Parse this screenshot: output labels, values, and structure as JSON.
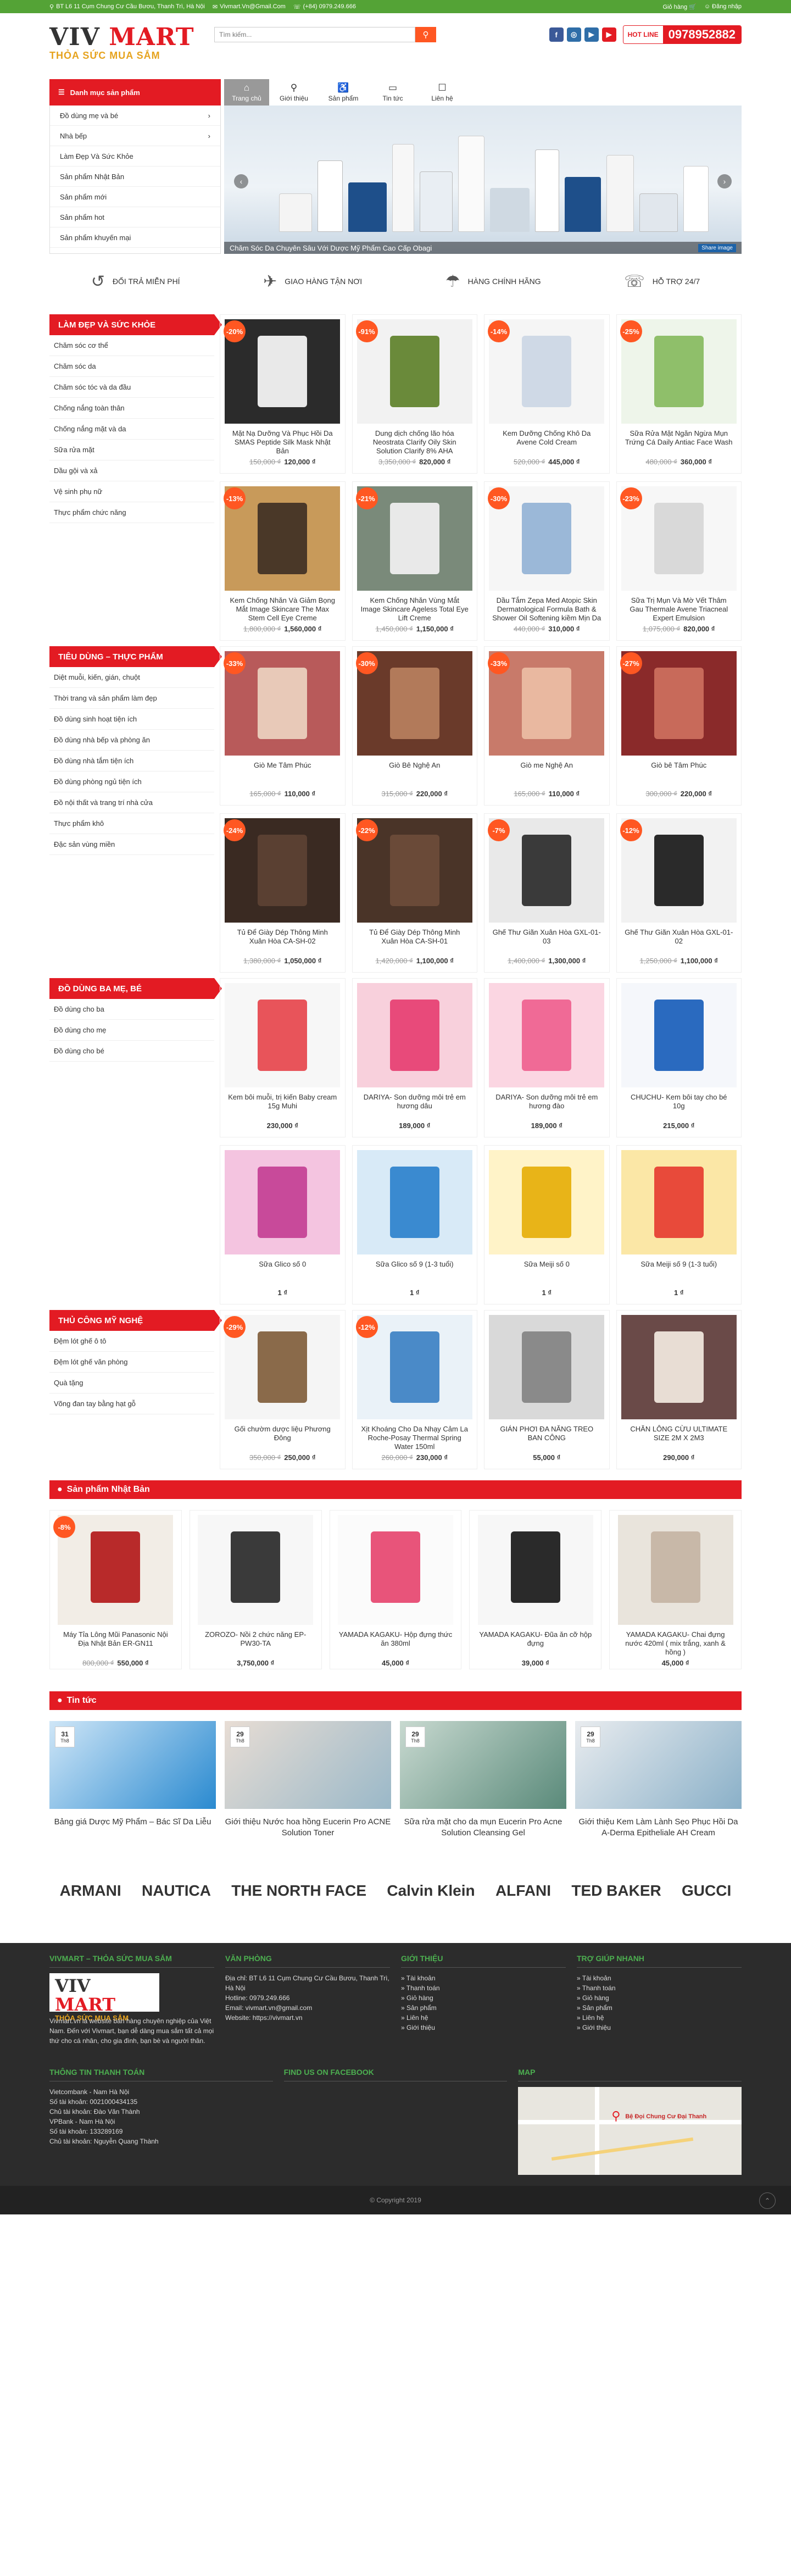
{
  "topbar": {
    "address": "BT L6 11 Cụm Chung Cư Cầu Bươu, Thanh Trì, Hà Nội",
    "email": "Vivmart.Vn@Gmail.Com",
    "phone": "(+84) 0979.249.666",
    "cart": "Giỏ hàng",
    "login": "Đăng nhập"
  },
  "header": {
    "logo_main_a": "VIV",
    "logo_main_b": "MART",
    "logo_tagline": "THỎA SỨC MUA SẮM",
    "search_placeholder": "Tìm kiếm...",
    "hotline_label": "HOT LINE",
    "hotline_number": "0978952882"
  },
  "socials": [
    {
      "icon": "facebook-icon",
      "glyph": "f",
      "color": "#3b5998"
    },
    {
      "icon": "instagram-icon",
      "glyph": "◎",
      "color": "#2f6ea8"
    },
    {
      "icon": "youtube-icon",
      "glyph": "▶",
      "color": "#2f6ea8"
    },
    {
      "icon": "youtube-red-icon",
      "glyph": "▶",
      "color": "#e31b23"
    }
  ],
  "nav": {
    "category_title": "Danh mục sản phẩm",
    "items": [
      {
        "label": "Trang chủ",
        "icon": "⌂"
      },
      {
        "label": "Giới thiệu",
        "icon": "⚲"
      },
      {
        "label": "Sản phẩm",
        "icon": "♿"
      },
      {
        "label": "Tin tức",
        "icon": "▭"
      },
      {
        "label": "Liên hệ",
        "icon": "☐"
      }
    ]
  },
  "category_menu": [
    {
      "label": "Đồ dùng mẹ và bé",
      "arrow": "›"
    },
    {
      "label": "Nhà bếp",
      "arrow": "›"
    },
    {
      "label": "Làm Đẹp Và Sức Khỏe",
      "arrow": ""
    },
    {
      "label": "Sản phẩm Nhật Bản",
      "arrow": ""
    },
    {
      "label": "Sản phẩm mới",
      "arrow": ""
    },
    {
      "label": "Sản phẩm hot",
      "arrow": ""
    },
    {
      "label": "Sản phẩm khuyến mại",
      "arrow": ""
    }
  ],
  "slider": {
    "caption": "Chăm Sóc Da Chuyên Sâu Với Dược Mỹ Phẩm Cao Cấp Obagi",
    "share": "Share image"
  },
  "services": [
    {
      "icon": "↺",
      "label": "ĐỔI TRẢ MIỄN PHÍ"
    },
    {
      "icon": "✈",
      "label": "GIAO HÀNG TẬN NƠI"
    },
    {
      "icon": "☂",
      "label": "HÀNG CHÍNH HÃNG"
    },
    {
      "icon": "☏",
      "label": "HỖ TRỢ 24/7"
    }
  ],
  "sections": [
    {
      "title": "LÀM ĐẸP VÀ SỨC KHỎE",
      "links": [
        "Chăm sóc cơ thể",
        "Chăm sóc da",
        "Chăm sóc tóc và da đầu",
        "Chống nắng toàn thân",
        "Chống nắng mặt và da",
        "Sữa rửa mặt",
        "Dầu gội và xả",
        "Vệ sinh phụ nữ",
        "Thực phẩm chức năng"
      ],
      "products": [
        {
          "name": "Mặt Nạ Dưỡng Và Phục Hồi Da SMAS Peptide Silk Mask Nhật Bản",
          "old": "150,000 ₫",
          "price": "120,000 ₫",
          "badge": "-20%",
          "c1": "#2b2b2b",
          "c2": "#e9e9e9"
        },
        {
          "name": "Dung dịch chống lão hóa Neostrata Clarify Oily Skin Solution Clarify 8% AHA",
          "old": "3,350,000 ₫",
          "price": "820,000 ₫",
          "badge": "-91%",
          "c1": "#f2f2f2",
          "c2": "#6a8a3a"
        },
        {
          "name": "Kem Dưỡng Chống Khô Da Avene Cold Cream",
          "old": "520,000 ₫",
          "price": "445,000 ₫",
          "badge": "-14%",
          "c1": "#f5f5f5",
          "c2": "#cfd9e6"
        },
        {
          "name": "Sữa Rửa Mặt Ngăn Ngừa Mụn Trứng Cá Daily Antiac Face Wash",
          "old": "480,000 ₫",
          "price": "360,000 ₫",
          "badge": "-25%",
          "c1": "#eef5ea",
          "c2": "#8fbf6a"
        },
        {
          "name": "Kem Chống Nhăn Và Giảm Bọng Mắt Image Skincare The Max Stem Cell Eye Creme",
          "old": "1,800,000 ₫",
          "price": "1,560,000 ₫",
          "badge": "-13%",
          "c1": "#c89a5a",
          "c2": "#4a3828"
        },
        {
          "name": "Kem Chống Nhăn Vùng Mắt Image Skincare Ageless Total Eye Lift Creme",
          "old": "1,450,000 ₫",
          "price": "1,150,000 ₫",
          "badge": "-21%",
          "c1": "#7a8a7a",
          "c2": "#e9e9e9"
        },
        {
          "name": "Dầu Tắm Zepa Med Atopic Skin Dermatological Formula Bath & Shower Oil Softening kiềm Mịn Da",
          "old": "440,000 ₫",
          "price": "310,000 ₫",
          "badge": "-30%",
          "c1": "#f6f6f6",
          "c2": "#9bb8d8"
        },
        {
          "name": "Sữa Trị Mụn Và Mờ Vết Thâm Gau Thermale Avene Triacneal Expert Emulsion",
          "old": "1,075,000 ₫",
          "price": "820,000 ₫",
          "badge": "-23%",
          "c1": "#f7f7f7",
          "c2": "#d9d9d9"
        }
      ]
    },
    {
      "title": "TIÊU DÙNG – THỰC PHẨM",
      "links": [
        "Diệt muỗi, kiến, gián, chuột",
        "Thời trang và sản phẩm làm đẹp",
        "Đồ dùng sinh hoạt tiện ích",
        "Đồ dùng nhà bếp và phòng ăn",
        "Đồ dùng nhà tắm tiện ích",
        "Đồ dùng phòng ngủ tiện ích",
        "Đồ nội thất và trang trí nhà cửa",
        "Thực phẩm khô",
        "Đặc sản vùng miền"
      ],
      "products": [
        {
          "name": "Giò Me Tâm Phúc",
          "old": "165,000 ₫",
          "price": "110,000 ₫",
          "badge": "-33%",
          "c1": "#b85a5a",
          "c2": "#e8c9b8"
        },
        {
          "name": "Giò Bê Nghệ An",
          "old": "315,000 ₫",
          "price": "220,000 ₫",
          "badge": "-30%",
          "c1": "#6a3a2a",
          "c2": "#b27a5a"
        },
        {
          "name": "Giò me Nghệ An",
          "old": "165,000 ₫",
          "price": "110,000 ₫",
          "badge": "-33%",
          "c1": "#c87a6a",
          "c2": "#e9b8a0"
        },
        {
          "name": "Giò bê Tâm Phúc",
          "old": "300,000 ₫",
          "price": "220,000 ₫",
          "badge": "-27%",
          "c1": "#8a2a2a",
          "c2": "#c86a5a"
        },
        {
          "name": "Tủ Để Giày Dép Thông Minh Xuân Hòa CA-SH-02",
          "old": "1,380,000 ₫",
          "price": "1,050,000 ₫",
          "badge": "-24%",
          "c1": "#3a2a22",
          "c2": "#5a4032"
        },
        {
          "name": "Tủ Để Giày Dép Thông Minh Xuân Hòa CA-SH-01",
          "old": "1,420,000 ₫",
          "price": "1,100,000 ₫",
          "badge": "-22%",
          "c1": "#4a3428",
          "c2": "#6a4a38"
        },
        {
          "name": "Ghế Thư Giãn Xuân Hòa GXL-01-03",
          "old": "1,400,000 ₫",
          "price": "1,300,000 ₫",
          "badge": "-7%",
          "c1": "#e9e9e9",
          "c2": "#3a3a3a"
        },
        {
          "name": "Ghế Thư Giãn Xuân Hòa GXL-01-02",
          "old": "1,250,000 ₫",
          "price": "1,100,000 ₫",
          "badge": "-12%",
          "c1": "#f2f2f2",
          "c2": "#2a2a2a"
        }
      ]
    },
    {
      "title": "ĐỒ DÙNG BA MẸ, BÉ",
      "links": [
        "Đồ dùng cho ba",
        "Đồ dùng cho mẹ",
        "Đồ dùng cho bé"
      ],
      "products": [
        {
          "name": "Kem bôi muỗi, trị kiến Baby cream 15g Muhi",
          "old": "",
          "price": "230,000 ₫",
          "badge": "",
          "c1": "#f7f7f7",
          "c2": "#e8545a"
        },
        {
          "name": "DARIYA- Son dưỡng môi trẻ em hương dâu",
          "old": "",
          "price": "189,000 ₫",
          "badge": "",
          "c1": "#f8d0dc",
          "c2": "#e84a7a"
        },
        {
          "name": "DARIYA- Son dưỡng môi trẻ em hương đào",
          "old": "",
          "price": "189,000 ₫",
          "badge": "",
          "c1": "#fbd6e2",
          "c2": "#f06a96"
        },
        {
          "name": "CHUCHU- Kem bôi tay cho bé 10g",
          "old": "",
          "price": "215,000 ₫",
          "badge": "",
          "c1": "#f5f7fb",
          "c2": "#2a6abf"
        },
        {
          "name": "Sữa Glico số 0",
          "old": "",
          "price": "1 ₫",
          "badge": "",
          "c1": "#f4c4e0",
          "c2": "#c84a9a"
        },
        {
          "name": "Sữa Glico số 9 (1-3 tuổi)",
          "old": "",
          "price": "1 ₫",
          "badge": "",
          "c1": "#d8eaf7",
          "c2": "#3a8ad0"
        },
        {
          "name": "Sữa Meiji số 0",
          "old": "",
          "price": "1 ₫",
          "badge": "",
          "c1": "#fff3c8",
          "c2": "#e8b418"
        },
        {
          "name": "Sữa Meiji số 9 (1-3 tuổi)",
          "old": "",
          "price": "1 ₫",
          "badge": "",
          "c1": "#fbe7a6",
          "c2": "#e84a3a"
        }
      ]
    },
    {
      "title": "THỦ CÔNG MỸ NGHỆ",
      "links": [
        "Đệm lót ghế ô tô",
        "Đệm lót ghế văn phòng",
        "Quà tặng",
        "Võng đan tay bằng hạt gỗ"
      ],
      "products": [
        {
          "name": "Gối chườm dược liệu Phương Đông",
          "old": "350,000 ₫",
          "price": "250,000 ₫",
          "badge": "-29%",
          "c1": "#f5f5f5",
          "c2": "#8a6a4a"
        },
        {
          "name": "Xịt Khoáng Cho Da Nhạy Cảm La Roche-Posay Thermal Spring Water 150ml",
          "old": "260,000 ₫",
          "price": "230,000 ₫",
          "badge": "-12%",
          "c1": "#eaf2f8",
          "c2": "#4a8ac8"
        },
        {
          "name": "GIÁN PHƠI ĐA NĂNG TREO BAN CÔNG",
          "old": "",
          "price": "55,000 ₫",
          "badge": "",
          "c1": "#d9d9d9",
          "c2": "#8a8a8a"
        },
        {
          "name": "CHĂN LÔNG CỪU ULTIMATE SIZE 2M X 2M3",
          "old": "",
          "price": "290,000 ₫",
          "badge": "",
          "c1": "#6a4a48",
          "c2": "#e8ddd4"
        }
      ]
    }
  ],
  "japan": {
    "title": "Sản phẩm Nhật Bản",
    "products": [
      {
        "name": "Máy Tỉa Lông Mũi Panasonic Nội Địa Nhật Bản ER-GN11",
        "old": "800,000 ₫",
        "price": "550,000 ₫",
        "badge": "-8%",
        "c1": "#f2ede6",
        "c2": "#b82a2a"
      },
      {
        "name": "ZOROZO- Nồi 2 chức năng EP-PW30-TA",
        "old": "",
        "price": "3,750,000 ₫",
        "badge": "",
        "c1": "#f7f7f7",
        "c2": "#3a3a3a"
      },
      {
        "name": "YAMADA KAGAKU- Hộp đựng thức ăn 380ml",
        "old": "",
        "price": "45,000 ₫",
        "badge": "",
        "c1": "#fbfbfb",
        "c2": "#e8547a"
      },
      {
        "name": "YAMADA KAGAKU- Đũa ăn cỡ hộp đựng",
        "old": "",
        "price": "39,000 ₫",
        "badge": "",
        "c1": "#f7f7f7",
        "c2": "#2a2a2a"
      },
      {
        "name": "YAMADA KAGAKU- Chai đựng nước 420ml ( mix trắng, xanh & hồng )",
        "old": "",
        "price": "45,000 ₫",
        "badge": "",
        "c1": "#e9e4dc",
        "c2": "#c8b8a8"
      }
    ]
  },
  "news": {
    "title": "Tin tức",
    "items": [
      {
        "day": "31",
        "month": "Th8",
        "title": "Bảng giá Dược Mỹ Phẩm – Bác Sĩ Da Liễu",
        "c1": "#cfe6f7",
        "c2": "#2a8ad0"
      },
      {
        "day": "29",
        "month": "Th8",
        "title": "Giới thiệu Nước hoa hồng Eucerin Pro ACNE Solution Toner",
        "c1": "#e8ddd4",
        "c2": "#9ab8c8"
      },
      {
        "day": "29",
        "month": "Th8",
        "title": "Sữa rửa mặt cho da mụn Eucerin Pro Acne Solution Cleansing Gel",
        "c1": "#c8d9d0",
        "c2": "#5a8a7a"
      },
      {
        "day": "29",
        "month": "Th8",
        "title": "Giới thiệu Kem Làm Lành Sẹo Phục Hồi Da A-Derma Epitheliale AH Cream",
        "c1": "#e9ecef",
        "c2": "#8ab0c8"
      }
    ]
  },
  "brands": [
    "ARMANI",
    "NAUTICA",
    "THE NORTH FACE",
    "Calvin Klein",
    "ALFANI",
    "TED BAKER",
    "GUCCI"
  ],
  "footer": {
    "about_title": "VIVMART – THỎA SỨC MUA SẮM",
    "about_text": "Vivmart.vn là website bán hàng chuyên nghiệp của Việt Nam. Đến với Vivmart, bạn dễ dàng mua sắm tất cả mọi thứ cho cá nhân, cho gia đình, bạn bè và người thân.",
    "office_title": "VĂN PHÒNG",
    "office_lines": [
      "Địa chỉ: BT L6 11 Cụm Chung Cư Cầu Bươu, Thanh Trì, Hà Nội",
      "Hotline: 0979.249.666",
      "Email: vivmart.vn@gmail.com",
      "Website: https://vivmart.vn"
    ],
    "intro_title": "GIỚI THIỆU",
    "intro_links": [
      "Tài khoản",
      "Thanh toán",
      "Giỏ hàng",
      "Sản phẩm",
      "Liên hệ",
      "Giới thiệu"
    ],
    "help_title": "TRỢ GIÚP NHANH",
    "help_links": [
      "Tài khoản",
      "Thanh toán",
      "Giỏ hàng",
      "Sản phẩm",
      "Liên hệ",
      "Giới thiệu"
    ],
    "pay_title": "THÔNG TIN THANH TOÁN",
    "pay_lines": [
      "Vietcombank - Nam Hà Nội",
      "Số tài khoản: 0021000434135",
      "Chủ tài khoản: Đào Văn Thành",
      "VPBank - Nam Hà Nội",
      "Số tài khoản: 133289169",
      "Chủ tài khoản: Nguyễn Quang Thành"
    ],
    "fb_title": "FIND US ON FACEBOOK",
    "map_title": "MAP",
    "map_label": "Bệ Đọi Chung Cư Đại Thanh",
    "copyright": "© Copyright 2019"
  }
}
